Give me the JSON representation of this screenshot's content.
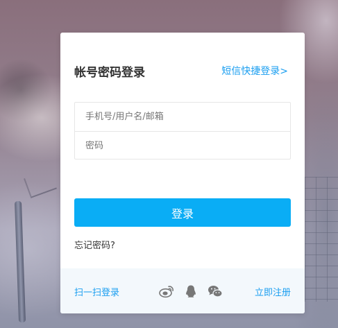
{
  "login": {
    "title": "帐号密码登录",
    "sms_login_link": "短信快捷登录>",
    "username_placeholder": "手机号/用户名/邮箱",
    "password_placeholder": "密码",
    "submit_label": "登录",
    "forgot_password": "忘记密码?"
  },
  "footer": {
    "qr_login": "扫一扫登录",
    "register": "立即注册",
    "social_icons": [
      "weibo-icon",
      "qq-icon",
      "wechat-icon"
    ]
  },
  "colors": {
    "accent": "#0aadf5",
    "link": "#1a9ef0",
    "footer_bg": "#f3f8fc"
  }
}
